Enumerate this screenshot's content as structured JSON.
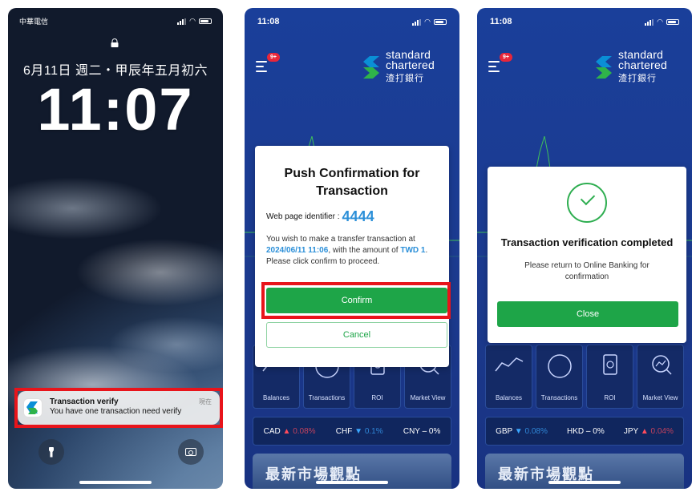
{
  "lockscreen": {
    "carrier": "中華電信",
    "date": "6月11日 週二・甲辰年五月初六",
    "time": "11:07",
    "notification": {
      "title": "Transaction verify",
      "body": "You have one transaction need verify",
      "time": "現在"
    }
  },
  "confirm_screen": {
    "status_time": "11:08",
    "badge": "9+",
    "logo": {
      "line1": "standard",
      "line2": "chartered",
      "zh": "渣打銀行"
    },
    "modal": {
      "title": "Push Confirmation for Transaction",
      "webid_label": "Web page identifier :",
      "webid_code": "4444",
      "desc_prefix": "You wish to make a transfer transaction at ",
      "desc_datetime": "2024/06/11 11:06",
      "desc_mid": ", with the amount of ",
      "desc_amount": "TWD 1",
      "desc_suffix": ". Please click confirm to proceed.",
      "confirm_label": "Confirm",
      "cancel_label": "Cancel"
    },
    "tiles": [
      "Balances",
      "Transactions",
      "ROI",
      "Market View"
    ],
    "ticker": [
      {
        "code": "CAD",
        "arrow": "▲",
        "change": "0.08%",
        "dir": "up"
      },
      {
        "code": "CHF",
        "arrow": "▼",
        "change": "0.1%",
        "dir": "down"
      },
      {
        "code": "CNY",
        "arrow": "–",
        "change": "0%",
        "dir": "flat"
      }
    ],
    "banner": "最新市場觀點"
  },
  "done_screen": {
    "status_time": "11:08",
    "badge": "9+",
    "logo": {
      "line1": "standard",
      "line2": "chartered",
      "zh": "渣打銀行"
    },
    "modal": {
      "title": "Transaction verification completed",
      "subtitle": "Please return to Online Banking for confirmation",
      "close_label": "Close"
    },
    "tiles": [
      "Balances",
      "Transactions",
      "ROI",
      "Market View"
    ],
    "ticker": [
      {
        "code": "GBP",
        "arrow": "▼",
        "change": "0.08%",
        "dir": "down"
      },
      {
        "code": "HKD",
        "arrow": "–",
        "change": "0%",
        "dir": "flat"
      },
      {
        "code": "JPY",
        "arrow": "▲",
        "change": "0.04%",
        "dir": "up"
      }
    ],
    "banner": "最新市場觀點"
  },
  "colors": {
    "brand_green": "#1ea548",
    "bank_blue": "#1c3a8e",
    "highlight_red": "#e8141b",
    "link_blue": "#2b8fd8"
  },
  "icons": [
    "lock-icon",
    "flashlight-icon",
    "camera-icon",
    "menu-icon",
    "check-icon",
    "signal-icon",
    "wifi-icon",
    "battery-icon"
  ]
}
